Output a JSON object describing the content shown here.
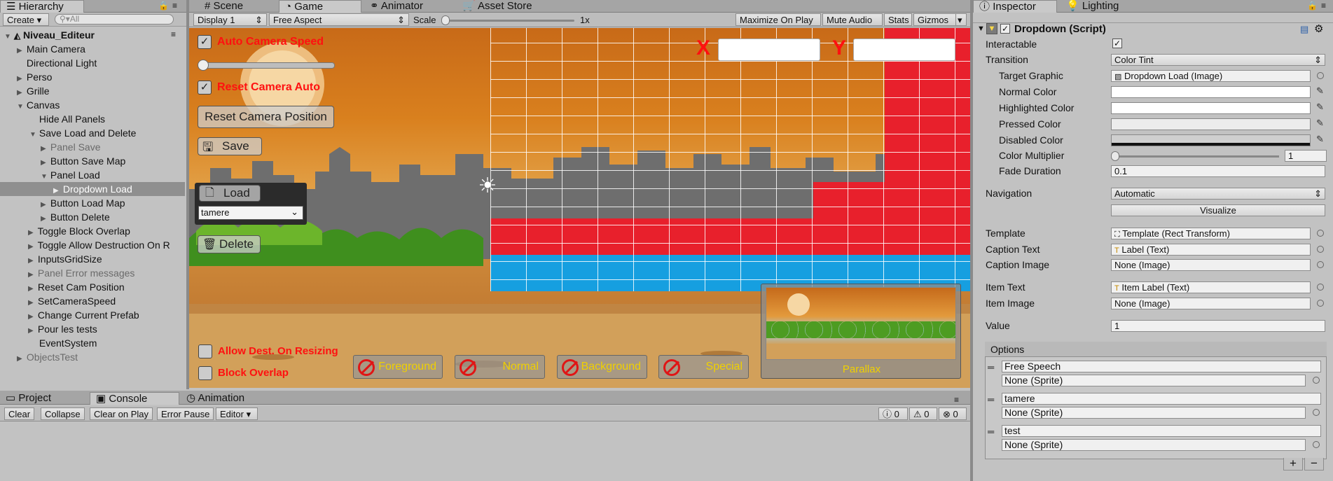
{
  "hierarchy": {
    "tab": "Hierarchy",
    "create": "Create",
    "search_placeholder": "All",
    "scene": "Niveau_Editeur",
    "items": [
      {
        "label": "Main Camera",
        "tri": "▶"
      },
      {
        "label": "Directional Light",
        "tri": ""
      },
      {
        "label": "Perso",
        "tri": "▶"
      },
      {
        "label": "Grille",
        "tri": "▶"
      },
      {
        "label": "Canvas",
        "tri": "▼"
      },
      {
        "label": "Hide All Panels",
        "tri": ""
      },
      {
        "label": "Save Load and Delete",
        "tri": "▼"
      },
      {
        "label": "Panel Save",
        "tri": "▶"
      },
      {
        "label": "Button Save Map",
        "tri": "▶"
      },
      {
        "label": "Panel Load",
        "tri": "▼"
      },
      {
        "label": "Dropdown Load",
        "tri": "▶"
      },
      {
        "label": "Button Load Map",
        "tri": "▶"
      },
      {
        "label": "Button Delete",
        "tri": "▶"
      },
      {
        "label": "Toggle Block Overlap",
        "tri": "▶"
      },
      {
        "label": "Toggle Allow Destruction On R",
        "tri": "▶"
      },
      {
        "label": "InputsGridSize",
        "tri": "▶"
      },
      {
        "label": "Panel Error messages",
        "tri": "▶"
      },
      {
        "label": "Reset Cam Position",
        "tri": "▶"
      },
      {
        "label": "SetCameraSpeed",
        "tri": "▶"
      },
      {
        "label": "Change Current Prefab",
        "tri": "▶"
      },
      {
        "label": "Pour les tests",
        "tri": "▶"
      },
      {
        "label": "EventSystem",
        "tri": ""
      },
      {
        "label": "ObjectsTest",
        "tri": "▶"
      }
    ]
  },
  "top_tabs": {
    "scene": "Scene",
    "game": "Game",
    "animator": "Animator",
    "asset_store": "Asset Store"
  },
  "game_toolbar": {
    "display": "Display 1",
    "aspect": "Free Aspect",
    "scale_label": "Scale",
    "scale_value": "1x",
    "maximize": "Maximize On Play",
    "mute": "Mute Audio",
    "stats": "Stats",
    "gizmos": "Gizmos"
  },
  "game_view": {
    "auto_camera_speed": "Auto Camera Speed",
    "reset_camera_auto": "Reset Camera Auto",
    "reset_camera_position": "Reset Camera Position",
    "save": "Save",
    "load": "Load",
    "dropdown_value": "tamere",
    "delete": "Delete",
    "x_label": "X",
    "y_label": "Y",
    "allow_dest": "Allow Dest. On Resizing",
    "block_overlap": "Block Overlap",
    "layers": [
      "Foreground",
      "Normal",
      "Background",
      "Special"
    ],
    "parallax": "Parallax",
    "colors": {
      "red": "#e8202c",
      "blue": "#169fe0",
      "sky": "#d9801e"
    }
  },
  "bottom_panel": {
    "tabs": {
      "project": "Project",
      "console": "Console",
      "animation": "Animation"
    },
    "buttons": {
      "clear": "Clear",
      "collapse": "Collapse",
      "clear_on_play": "Clear on Play",
      "error_pause": "Error Pause",
      "editor": "Editor"
    },
    "counts": {
      "info": "0",
      "warn": "0",
      "error": "0"
    }
  },
  "inspector": {
    "tabs": {
      "inspector": "Inspector",
      "lighting": "Lighting"
    },
    "component": "Dropdown (Script)",
    "fields": {
      "interactable": "Interactable",
      "transition": "Transition",
      "transition_value": "Color Tint",
      "target_graphic": "Target Graphic",
      "target_graphic_value": "Dropdown Load (Image)",
      "normal_color": "Normal Color",
      "highlighted_color": "Highlighted Color",
      "pressed_color": "Pressed Color",
      "disabled_color": "Disabled Color",
      "color_multiplier": "Color Multiplier",
      "color_multiplier_value": "1",
      "fade_duration": "Fade Duration",
      "fade_duration_value": "0.1",
      "navigation": "Navigation",
      "navigation_value": "Automatic",
      "visualize": "Visualize",
      "template": "Template",
      "template_value": "Template (Rect Transform)",
      "caption_text": "Caption Text",
      "caption_text_value": "Label (Text)",
      "caption_image": "Caption Image",
      "caption_image_value": "None (Image)",
      "item_text": "Item Text",
      "item_text_value": "Item Label (Text)",
      "item_image": "Item Image",
      "item_image_value": "None (Image)",
      "value": "Value",
      "value_value": "1"
    },
    "options_header": "Options",
    "options": [
      {
        "text": "Free Speech",
        "sprite": "None (Sprite)"
      },
      {
        "text": "tamere",
        "sprite": "None (Sprite)"
      },
      {
        "text": "test",
        "sprite": "None (Sprite)"
      }
    ],
    "plus": "+",
    "minus": "−"
  }
}
